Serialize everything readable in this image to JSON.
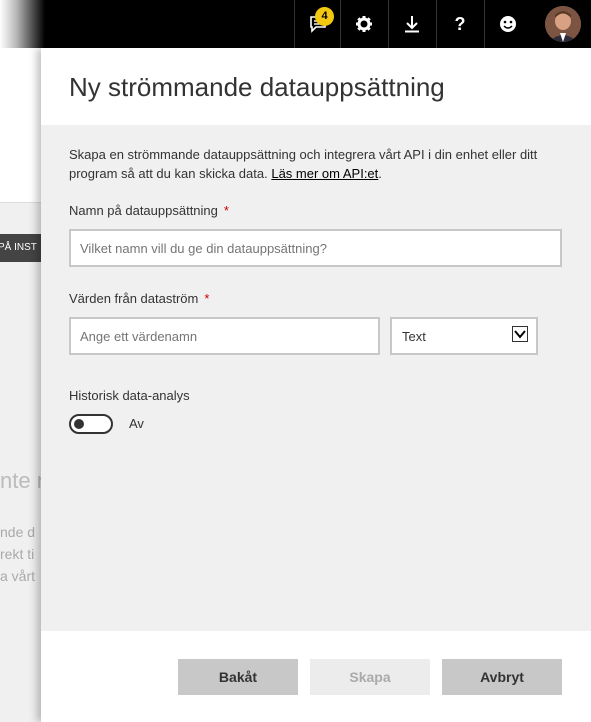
{
  "topbar": {
    "notification_count": "4",
    "icons": [
      "notification-icon",
      "gear-icon",
      "download-icon",
      "help-icon",
      "smiley-icon",
      "avatar"
    ]
  },
  "background_page": {
    "tag": "PÅ INST",
    "heading_fragment": "nte r",
    "line1": "nde d",
    "line2": "rekt ti",
    "line3": "a vårt"
  },
  "panel": {
    "title": "Ny strömmande datauppsättning",
    "description": "Skapa en strömmande datauppsättning och integrera vårt API i din enhet eller ditt program så att du kan skicka data.",
    "learn_more": "Läs mer om API:et",
    "description_end": ".",
    "name_label": "Namn på datauppsättning",
    "required_mark": "*",
    "name_placeholder": "Vilket namn vill du ge din datauppsättning?",
    "values_label": "Värden från dataström",
    "value_placeholder": "Ange ett värdenamn",
    "type_selected": "Text",
    "history_label": "Historisk data-analys",
    "toggle_state": "Av"
  },
  "footer": {
    "back_label": "Bakåt",
    "create_label": "Skapa",
    "cancel_label": "Avbryt"
  }
}
